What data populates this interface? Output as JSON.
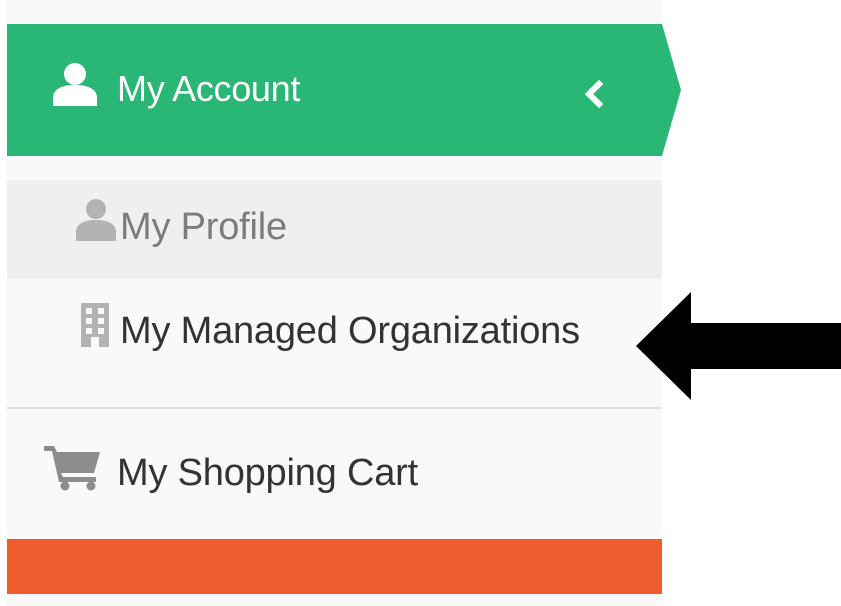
{
  "sidebar": {
    "header": {
      "title": "My Account",
      "icon": "user-icon",
      "toggle_icon": "chevron-left-icon",
      "color": "#2ab674"
    },
    "items": [
      {
        "label": "My Profile",
        "icon": "user-icon",
        "active": true
      },
      {
        "label": "My Managed Organizations",
        "icon": "building-icon"
      },
      {
        "label": "My Shopping Cart",
        "icon": "shopping-cart-icon"
      }
    ],
    "footer_color": "#ee5b2d"
  },
  "annotation": {
    "icon": "arrow-left-icon",
    "color": "#000000"
  }
}
